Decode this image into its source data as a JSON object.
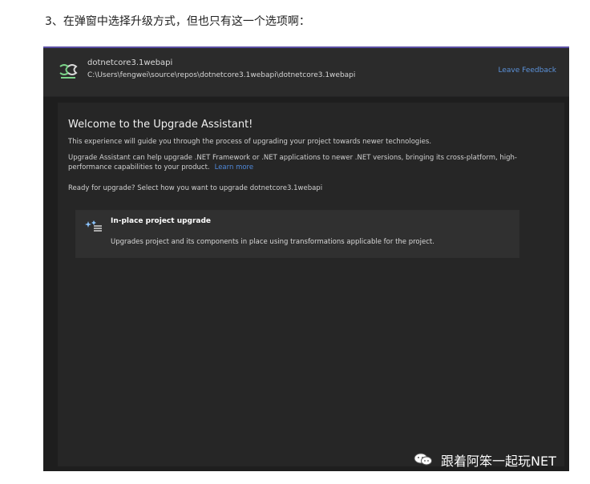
{
  "article": {
    "step_caption": "3、在弹窗中选择升级方式，但也只有这一个选项啊："
  },
  "upgrade_window": {
    "project_name": "dotnetcore3.1webapi",
    "project_path": "C:\\Users\\fengwei\\source\\repos\\dotnetcore3.1webapi\\dotnetcore3.1webapi",
    "leave_feedback_label": "Leave Feedback",
    "welcome_title": "Welcome to the Upgrade Assistant!",
    "description_1": "This experience will guide you through the process of upgrading your project towards newer technologies.",
    "description_2_line_1": "Upgrade Assistant can help upgrade .NET Framework or .NET applications to newer .NET versions, bringing its cross-platform, high-",
    "description_2_line_2": "performance capabilities to your product.",
    "learn_more_label": "Learn more",
    "ready_prompt": "Ready for upgrade? Select how you want to upgrade dotnetcore3.1webapi",
    "option": {
      "title": "In-place project upgrade",
      "description": "Upgrades project and its components in place using transformations applicable for the project."
    }
  },
  "watermark": {
    "text": "跟着阿笨一起玩NET"
  },
  "colors": {
    "dialog_background": "#1e1e1e",
    "panel_background": "#262626",
    "option_background": "#303030",
    "accent_link": "#4f88d8",
    "top_strip": "#5a4fa3"
  },
  "icons": {
    "project": "project-icon",
    "upgrade_option": "sparkle-list-icon",
    "watermark": "wechat-icon"
  }
}
